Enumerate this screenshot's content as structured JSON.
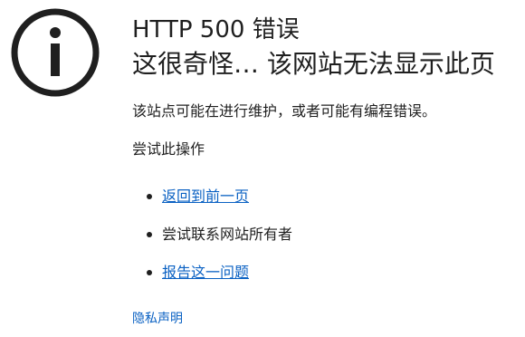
{
  "page": {
    "icon": "info-icon",
    "error_code": "HTTP 500 错误",
    "title": "这很奇怪… 该网站无法显示此页",
    "description": "该站点可能在进行维护，或者可能有编程错误。",
    "try_heading": "尝试此操作",
    "actions": [
      {
        "label": "返回到前一页",
        "is_link": true
      },
      {
        "label": "尝试联系网站所有者",
        "is_link": false
      },
      {
        "label": "报告这一问题",
        "is_link": true
      }
    ],
    "privacy_label": "隐私声明"
  },
  "colors": {
    "text": "#1f1f1f",
    "link": "#0a61c3",
    "background": "#ffffff"
  }
}
